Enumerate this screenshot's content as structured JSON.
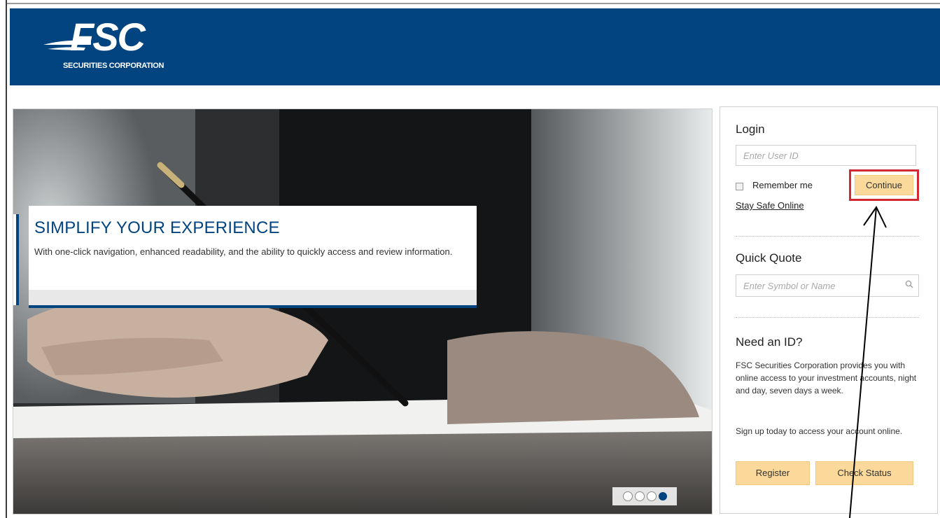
{
  "header": {
    "logo_main": "FSC",
    "logo_sub": "SECURITIES CORPORATION",
    "brand_color": "#02447f"
  },
  "hero": {
    "title": "SIMPLIFY YOUR EXPERIENCE",
    "text": "With one-click navigation, enhanced readability, and the ability to quickly access and review information.",
    "slide_count": 4,
    "active_slide": 4
  },
  "login": {
    "heading": "Login",
    "userid_placeholder": "Enter User ID",
    "remember_label": "Remember me",
    "continue_label": "Continue",
    "safe_link": "Stay Safe Online"
  },
  "quote": {
    "heading": "Quick Quote",
    "placeholder": "Enter Symbol or Name",
    "icon": "search-icon"
  },
  "need_id": {
    "heading": "Need an ID?",
    "text1": "FSC Securities Corporation provides you with online access to your investment accounts, night and day, seven days a week.",
    "text2": "Sign up today to access your account online.",
    "register_label": "Register",
    "check_status_label": "Check Status"
  },
  "colors": {
    "accent_button": "#fad99b",
    "highlight": "#d12a34"
  }
}
